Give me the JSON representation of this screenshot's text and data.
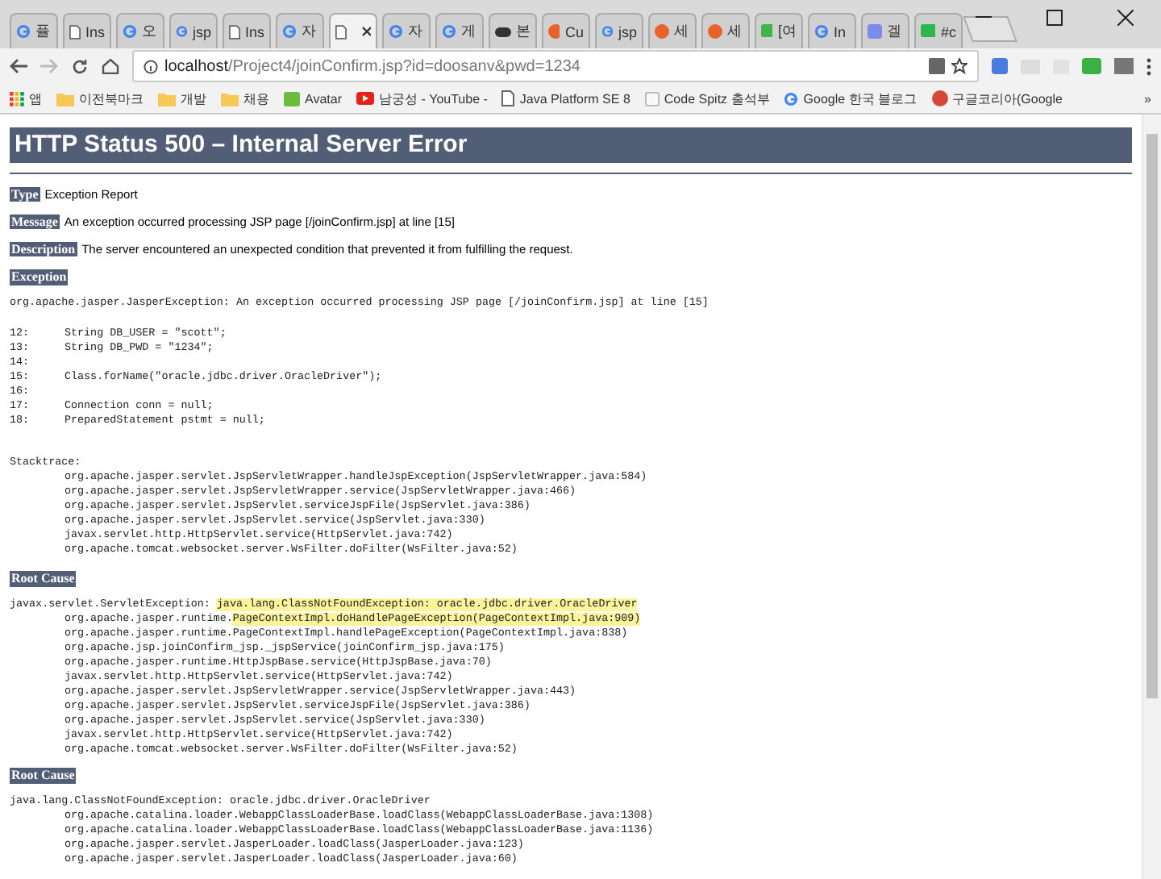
{
  "tabs": [
    {
      "kind": "google",
      "label": "퓰",
      "selected": false
    },
    {
      "kind": "doc",
      "label": "Ins",
      "selected": false
    },
    {
      "kind": "google",
      "label": "오",
      "selected": false
    },
    {
      "kind": "google",
      "label": "jsp",
      "selected": false
    },
    {
      "kind": "doc",
      "label": "Ins",
      "selected": false
    },
    {
      "kind": "google",
      "label": "자",
      "selected": false
    },
    {
      "kind": "doc",
      "selected": true
    },
    {
      "kind": "google",
      "label": "자",
      "selected": false
    },
    {
      "kind": "google",
      "label": "게",
      "selected": false
    },
    {
      "kind": "game",
      "label": "본",
      "selected": false
    },
    {
      "kind": "orange",
      "label": "Cu",
      "selected": false
    },
    {
      "kind": "google",
      "label": "jsp",
      "selected": false
    },
    {
      "kind": "orange",
      "label": "세",
      "selected": false
    },
    {
      "kind": "orange",
      "label": "세",
      "selected": false
    },
    {
      "kind": "green",
      "label": "[여",
      "selected": false
    },
    {
      "kind": "google",
      "label": "In",
      "selected": false
    },
    {
      "kind": "photo",
      "label": "겔",
      "selected": false
    },
    {
      "kind": "chat",
      "label": "#c",
      "selected": false
    }
  ],
  "address": {
    "host": "localhost",
    "path": "/Project4/joinConfirm.jsp?id=doosanv&pwd=1234"
  },
  "bookmarks": [
    {
      "kind": "apps",
      "label": "앱"
    },
    {
      "kind": "folder",
      "label": "이전북마크"
    },
    {
      "kind": "folder",
      "label": "개발"
    },
    {
      "kind": "folder",
      "label": "채용"
    },
    {
      "kind": "green",
      "label": "Avatar"
    },
    {
      "kind": "youtube",
      "label": "남궁성 - YouTube -"
    },
    {
      "kind": "doc",
      "label": "Java Platform SE 8"
    },
    {
      "kind": "page",
      "label": "Code Spitz 출석부"
    },
    {
      "kind": "google",
      "label": "Google 한국 블로그"
    },
    {
      "kind": "gplus",
      "label": "구글코리아(Google"
    }
  ],
  "bookmarks_more": "»",
  "page": {
    "title": "HTTP Status 500 – Internal Server Error",
    "fields": [
      {
        "label": "Type",
        "value": "Exception Report"
      },
      {
        "label": "Message",
        "value": "An exception occurred processing JSP page [/joinConfirm.jsp] at line [15]"
      },
      {
        "label": "Description",
        "value": "The server encountered an unexpected condition that prevented it from fulfilling the request."
      }
    ],
    "sections": [
      {
        "heading": "Exception",
        "blocks": [
          {
            "kind": "plain",
            "lines": [
              "org.apache.jasper.JasperException: An exception occurred processing JSP page [/joinConfirm.jsp] at line [15]"
            ]
          },
          {
            "kind": "code",
            "lines": [
              {
                "number": "12:",
                "code": "String DB_USER = \"scott\";"
              },
              {
                "number": "13:",
                "code": "String DB_PWD = \"1234\";"
              },
              {
                "number": "14:"
              },
              {
                "number": "15:",
                "code": "Class.forName(\"oracle.jdbc.driver.OracleDriver\");"
              },
              {
                "number": "16:"
              },
              {
                "number": "17:",
                "code": "Connection conn = null;"
              },
              {
                "number": "18:",
                "code": "PreparedStatement pstmt = null;"
              }
            ]
          },
          {
            "kind": "stack",
            "head": "Stacktrace:",
            "lines": [
              "org.apache.jasper.servlet.JspServletWrapper.handleJspException(JspServletWrapper.java:584)",
              "org.apache.jasper.servlet.JspServletWrapper.service(JspServletWrapper.java:466)",
              "org.apache.jasper.servlet.JspServlet.serviceJspFile(JspServlet.java:386)",
              "org.apache.jasper.servlet.JspServlet.service(JspServlet.java:330)",
              "javax.servlet.http.HttpServlet.service(HttpServlet.java:742)",
              "org.apache.tomcat.websocket.server.WsFilter.doFilter(WsFilter.java:52)"
            ]
          }
        ]
      },
      {
        "heading": "Root Cause",
        "blocks": [
          {
            "kind": "trace",
            "head": [
              {
                "text": "javax.servlet.ServletException: ",
                "highlighted": false
              },
              {
                "text": "java.lang.ClassNotFoundException: oracle.jdbc.driver.OracleDriver",
                "highlighted": true
              }
            ],
            "lines": [
              [
                {
                  "text": "org.apache.jasper.runtime.",
                  "highlighted": false
                },
                {
                  "text": "PageContextImpl.doHandlePageException(PageContextImpl.java:909)",
                  "highlighted": true
                }
              ],
              [
                {
                  "text": "org.apache.jasper.runtime.PageContextImpl.handlePageException(PageContextImpl.java:838)",
                  "highlighted": false
                }
              ],
              [
                {
                  "text": "org.apache.jsp.joinConfirm_jsp._jspService(joinConfirm_jsp.java:175)",
                  "highlighted": false
                }
              ],
              [
                {
                  "text": "org.apache.jasper.runtime.HttpJspBase.service(HttpJspBase.java:70)",
                  "highlighted": false
                }
              ],
              [
                {
                  "text": "javax.servlet.http.HttpServlet.service(HttpServlet.java:742)",
                  "highlighted": false
                }
              ],
              [
                {
                  "text": "org.apache.jasper.servlet.JspServletWrapper.service(JspServletWrapper.java:443)",
                  "highlighted": false
                }
              ],
              [
                {
                  "text": "org.apache.jasper.servlet.JspServlet.serviceJspFile(JspServlet.java:386)",
                  "highlighted": false
                }
              ],
              [
                {
                  "text": "org.apache.jasper.servlet.JspServlet.service(JspServlet.java:330)",
                  "highlighted": false
                }
              ],
              [
                {
                  "text": "javax.servlet.http.HttpServlet.service(HttpServlet.java:742)",
                  "highlighted": false
                }
              ],
              [
                {
                  "text": "org.apache.tomcat.websocket.server.WsFilter.doFilter(WsFilter.java:52)",
                  "highlighted": false
                }
              ]
            ]
          }
        ]
      },
      {
        "heading": "Root Cause",
        "blocks": [
          {
            "kind": "stack",
            "head": "java.lang.ClassNotFoundException: oracle.jdbc.driver.OracleDriver",
            "lines": [
              "org.apache.catalina.loader.WebappClassLoaderBase.loadClass(WebappClassLoaderBase.java:1308)",
              "org.apache.catalina.loader.WebappClassLoaderBase.loadClass(WebappClassLoaderBase.java:1136)",
              "org.apache.jasper.servlet.JasperLoader.loadClass(JasperLoader.java:123)",
              "org.apache.jasper.servlet.JasperLoader.loadClass(JasperLoader.java:60)"
            ]
          }
        ]
      }
    ]
  }
}
